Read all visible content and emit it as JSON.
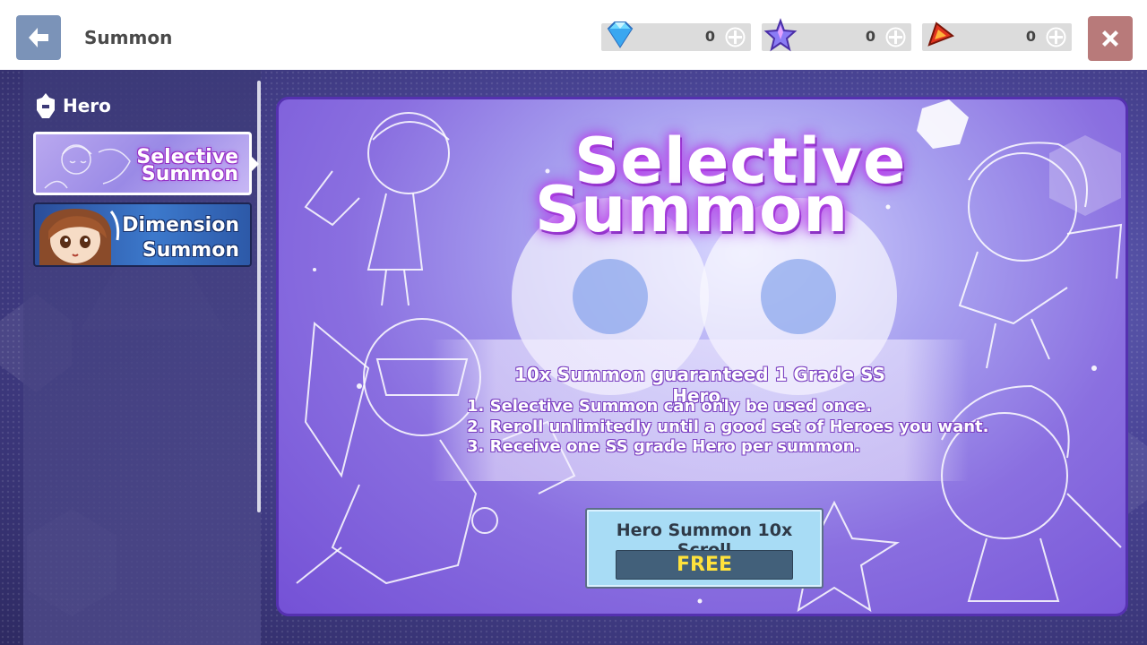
{
  "header": {
    "title": "Summon",
    "back_icon": "arrow-left-icon",
    "close_icon": "close-x-icon"
  },
  "currencies": [
    {
      "icon": "diamond-gem-icon",
      "value": "0"
    },
    {
      "icon": "star-crystal-icon",
      "value": "0"
    },
    {
      "icon": "red-badge-icon",
      "value": "0"
    }
  ],
  "sidebar": {
    "section_label": "Hero",
    "section_icon": "helmet-icon",
    "tabs": [
      {
        "line1": "Selective",
        "line2": "Summon",
        "selected": true
      },
      {
        "line1": "Dimension",
        "line2": "Summon",
        "selected": false
      }
    ]
  },
  "banner": {
    "title_line1": "Selective",
    "title_line2": "Summon",
    "heading": "10x Summon guaranteed 1 Grade SS Hero.",
    "rules": [
      "1. Selective Summon can only be used once.",
      "2. Reroll unlimitedly until a good set of Heroes you want.",
      "3. Receive one SS grade Hero per summon."
    ],
    "card_title": "Hero Summon 10x Scroll",
    "free_label": "FREE"
  },
  "colors": {
    "accent_purple": "#5531b0",
    "free_text": "#ffe23c",
    "card_bg": "#a8dcf5",
    "close_bg": "#b87a7a",
    "back_bg": "#7b93b8"
  }
}
